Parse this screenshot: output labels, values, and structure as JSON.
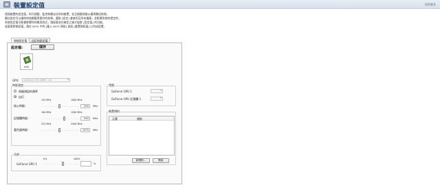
{
  "window": {
    "title": "裝置設定值",
    "help_link": "說明更多"
  },
  "description": {
    "line1": "透過裝置的設定值，你可調整、監控和最佳化你的裝置，並且調整效能以獲得最佳結果。",
    "line2": "最佳設定可以讓你的遊戲獲得更好的效果。選取 [設定] 會套用至所有檔案，並影響系統的穩定性。",
    "line3": "系統設定值可能會影響你的應用程式，請留意並在確定之後才變更 [設定值] 的功能。",
    "line4": "若要還原預設值，請在 BIOS 中的 [載入 BIOS 預設] 頁面 [重置預設值] 以完成設置。"
  },
  "tabs": [
    "效能設定值",
    "自訂的設定值"
  ],
  "profile": {
    "label": "設定檔:",
    "save_button": "儲存"
  },
  "gpu": {
    "tile_label": "GPU",
    "select_label": "GPU:",
    "select_value": "GeForce GTX 288M - #1"
  },
  "clock": {
    "group_title": "時脈速度",
    "radio_default": "原廠預設的頻率",
    "radio_custom": "自訂",
    "rows": [
      {
        "label": "核心時脈：",
        "min": "125 MHz",
        "max": "1000 MHz",
        "value": "550",
        "unit": "MHz",
        "fraction": 0.48
      },
      {
        "label": "記憶體時脈：",
        "min": "100 MHz",
        "max": "1500 MHz",
        "value": "950",
        "unit": "MHz",
        "fraction": 0.61
      },
      {
        "label": "著色器時脈：",
        "min": "312 MHz",
        "max": "2500 MHz",
        "value": "1375",
        "unit": "MHz",
        "fraction": 0.49
      }
    ]
  },
  "voltage": {
    "group_title": "電壓",
    "rows": [
      {
        "label": "GeForce GPU 1",
        "value": ""
      },
      {
        "label": "GeForce GPU 記憶體 1",
        "value": ""
      }
    ]
  },
  "rules": {
    "group_title": "裝置規則",
    "columns": [
      "元素",
      "規則"
    ],
    "new_button": "新規則...",
    "delete_button": "刪除"
  },
  "fan": {
    "group_title": "冷卻",
    "label": "GeForce GPU 1",
    "min": "0%",
    "max": "100%",
    "value": "",
    "unit": "%",
    "fraction": 0.55
  }
}
